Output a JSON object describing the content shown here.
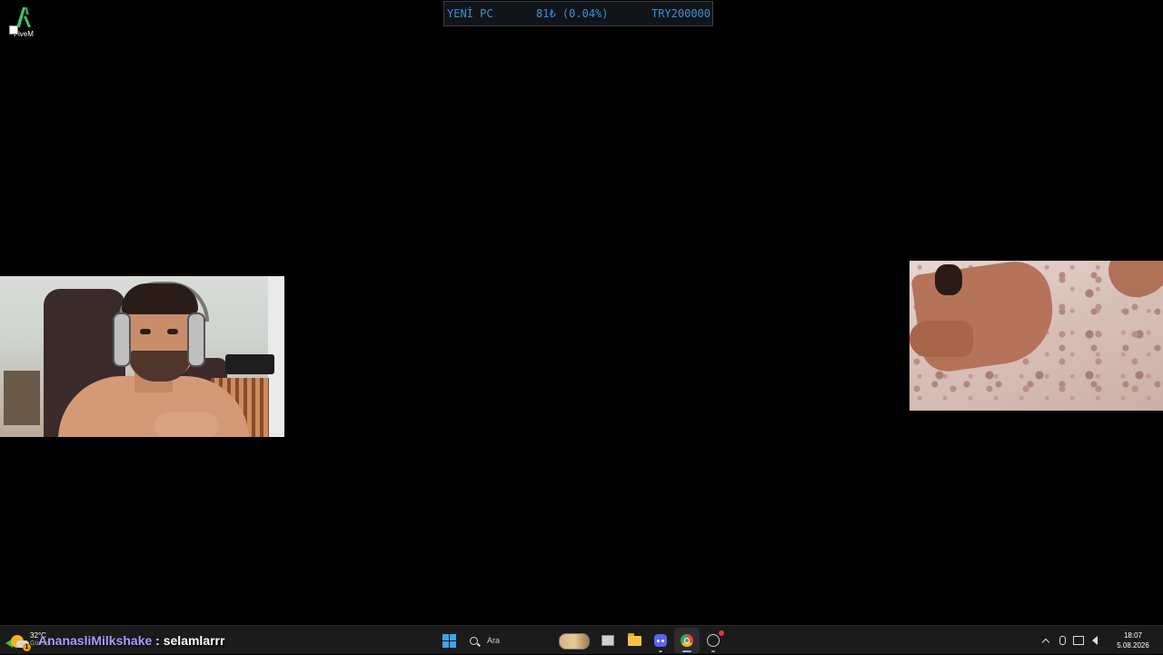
{
  "desktop": {
    "icons": [
      {
        "label": "FiveM"
      }
    ]
  },
  "ticker": {
    "name": "YENİ PC",
    "amount": "81₺ (0.04%)",
    "goal": "TRY200000"
  },
  "chat": {
    "user": "AnanasliMilkshake",
    "separator": " : ",
    "message": "selamlarrr"
  },
  "taskbar": {
    "weather": {
      "temp": "32°C",
      "condition": "Güneşli"
    },
    "search_placeholder": "Ara",
    "clock": {
      "time": "18:07",
      "date": "5.08.2026"
    }
  },
  "colors": {
    "ticker_text": "#3b8fd8",
    "chat_user": "#a8a0ff",
    "accent": "#3ea3f0"
  }
}
